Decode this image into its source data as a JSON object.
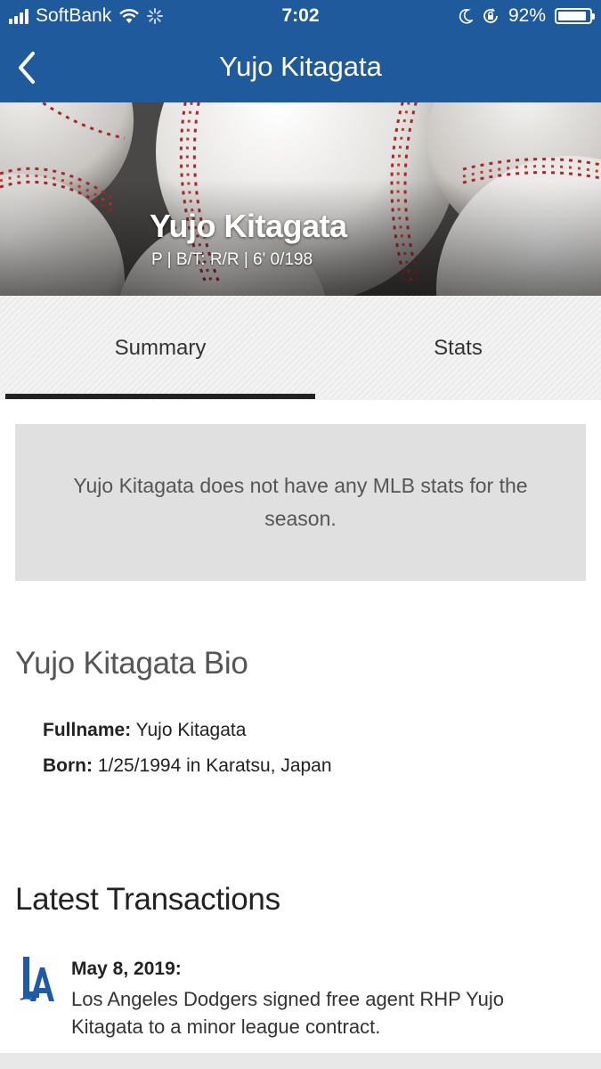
{
  "status_bar": {
    "carrier": "SoftBank",
    "time": "7:02",
    "battery_percent": "92%",
    "battery_level": 0.92,
    "icons": [
      "signal-icon",
      "wifi-icon",
      "loading-icon",
      "moon-icon",
      "orientation-lock-icon",
      "battery-icon"
    ]
  },
  "nav": {
    "title": "Yujo Kitagata",
    "back_icon": "chevron-left-icon"
  },
  "hero": {
    "name": "Yujo Kitagata",
    "meta": "P | B/T: R/R | 6' 0/198"
  },
  "tabs": [
    {
      "label": "Summary",
      "active": true
    },
    {
      "label": "Stats",
      "active": false
    }
  ],
  "notice": "Yujo Kitagata does not have any MLB stats for the season.",
  "bio": {
    "title": "Yujo Kitagata Bio",
    "fullname_label": "Fullname:",
    "fullname_value": "Yujo Kitagata",
    "born_label": "Born:",
    "born_value": "1/25/1994 in Karatsu, Japan"
  },
  "transactions": {
    "title": "Latest Transactions",
    "items": [
      {
        "logo": "dodgers-la-logo",
        "date": "May 8, 2019:",
        "text": "Los Angeles Dodgers signed free agent RHP Yujo Kitagata to a minor league contract."
      }
    ]
  },
  "colors": {
    "brand_blue": "#1f5a9c",
    "dodgers_blue": "#1e5aa8",
    "notice_bg": "#e0e0e0"
  }
}
